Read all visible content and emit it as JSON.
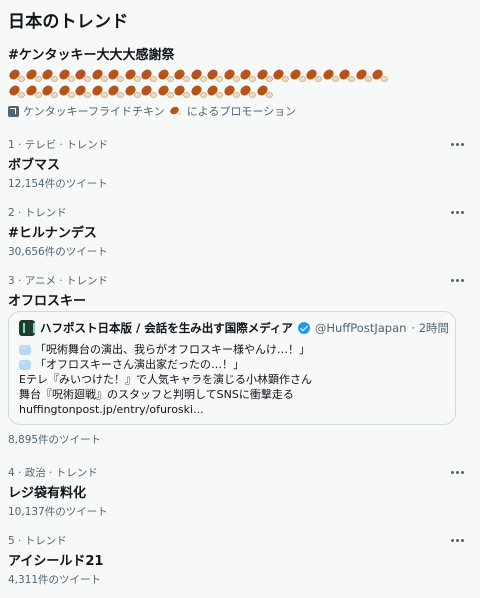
{
  "header": {
    "title": "日本のトレンド"
  },
  "promo": {
    "title": "#ケンタッキー大大大感謝祭",
    "emoji_rows": [
      23,
      16
    ],
    "promoted_by_prefix": "ケンタッキーフライドチキン",
    "promoted_by_suffix": "によるプロモーション",
    "icon": "promoted-icon"
  },
  "trends": [
    {
      "meta": "1 · テレビ · トレンド",
      "name": "ボブマス",
      "count": "12,154件のツイート"
    },
    {
      "meta": "2 · トレンド",
      "name": "#ヒルナンデス",
      "count": "30,656件のツイート"
    },
    {
      "meta": "3 · アニメ · トレンド",
      "name": "オフロスキー",
      "count": "8,895件のツイート"
    },
    {
      "meta": "4 · 政治 · トレンド",
      "name": "レジ袋有料化",
      "count": "10,137件のツイート"
    },
    {
      "meta": "5 · トレンド",
      "name": "アイシールド21",
      "count": "4,311件のツイート"
    }
  ],
  "card": {
    "author": "ハフポスト日本版 / 会話を生み出す国際メディア",
    "handle": "@HuffPostJapan",
    "time": "· 2時間",
    "quote1": "「呪術舞台の演出、我らがオフロスキー様やんけ…！」",
    "quote2": "「オフロスキーさん演出家だったの…！」",
    "line1": "Eテレ『みいつけた！』で人気キャラを演じる小林顕作さん",
    "line2": "舞台『呪術廻戦』のスタッフと判明してSNSに衝撃走る",
    "url": "huffingtonpost.jp/entry/ofuroski..."
  }
}
